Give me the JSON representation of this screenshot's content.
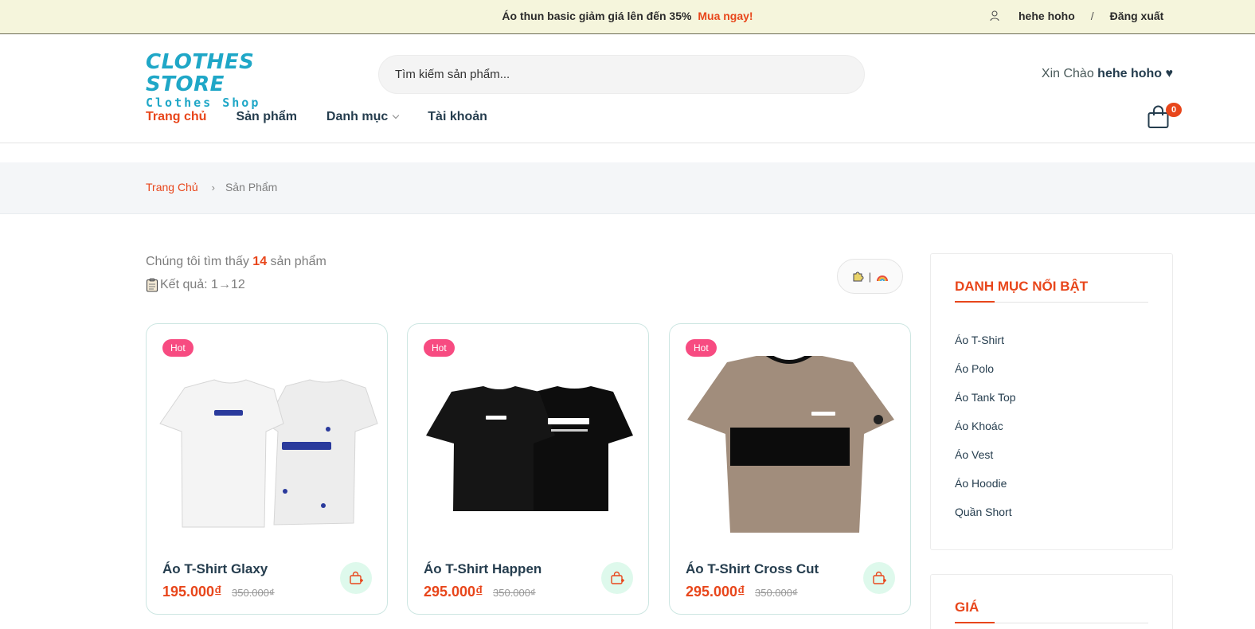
{
  "topbar": {
    "promo_text": "Áo thun basic giảm giá lên đến 35%",
    "promo_cta": "Mua ngay!",
    "username": "hehe hoho",
    "separator": "/",
    "logout": "Đăng xuất"
  },
  "header": {
    "logo_line1": "CLOTHES STORE",
    "logo_line2": "Clothes Shop",
    "search_placeholder": "Tìm kiếm sản phẩm...",
    "greeting_prefix": "Xin Chào",
    "greeting_name": "hehe hoho ♥",
    "cart_count": "0"
  },
  "nav": {
    "items": [
      "Trang chủ",
      "Sản phẩm",
      "Danh mục",
      "Tài khoản"
    ]
  },
  "breadcrumb": {
    "home": "Trang Chủ",
    "arrow": "›",
    "current": "Sản Phẩm"
  },
  "results": {
    "found_prefix": "Chúng tôi tìm thấy",
    "found_count": "14",
    "found_suffix": "sản phẩm",
    "range_text": "Kết quả: 1→12",
    "sort_divider": "|"
  },
  "products": [
    {
      "badge": "Hot",
      "name": "Áo T-Shirt Glaxy",
      "price": "195.000₫",
      "old_price": "350.000₫",
      "shirt_color": "#f1f1f1",
      "print_color": "#2a3a9c"
    },
    {
      "badge": "Hot",
      "name": "Áo T-Shirt Happen",
      "price": "295.000₫",
      "old_price": "350.000₫",
      "shirt_color": "#0b0b0b",
      "print_color": "#ffffff"
    },
    {
      "badge": "Hot",
      "name": "Áo T-Shirt Cross Cut",
      "price": "295.000₫",
      "old_price": "350.000₫",
      "shirt_color": "#a18d7c",
      "print_color": "#ffffff"
    }
  ],
  "sidebar": {
    "title": "DANH MỤC NỔI BẬT",
    "categories": [
      "Áo T-Shirt",
      "Áo Polo",
      "Áo Tank Top",
      "Áo Khoác",
      "Áo Vest",
      "Áo Hoodie",
      "Quần Short"
    ],
    "price_title": "GIÁ"
  },
  "colors": {
    "accent": "#e8461b",
    "brand": "#1fa7c7",
    "hot_badge": "#f74b81",
    "topbar_bg": "#f5f5dc"
  },
  "icons": {
    "user": "user-icon",
    "cart": "shopping-bag-icon",
    "add_to_cart": "add-to-cart-icon",
    "clipboard": "clipboard-icon",
    "sort_a": "puzzle-icon",
    "sort_b": "rainbow-icon"
  }
}
